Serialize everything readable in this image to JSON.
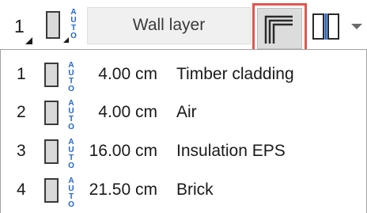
{
  "toolbar": {
    "layer_number": "1",
    "auto_label": [
      "A",
      "U",
      "T",
      "O"
    ],
    "layer_button_label": "Wall layer",
    "icons": {
      "swatch": "layer-swatch-icon",
      "corner": "corner-layers-icon",
      "split": "split-columns-icon",
      "dropdown": "chevron-down-icon"
    },
    "highlight_color": "#e2554f"
  },
  "layers": [
    {
      "number": "1",
      "thickness": "4.00 cm",
      "name": "Timber cladding"
    },
    {
      "number": "2",
      "thickness": "4.00 cm",
      "name": "Air"
    },
    {
      "number": "3",
      "thickness": "16.00 cm",
      "name": "Insulation EPS"
    },
    {
      "number": "4",
      "thickness": "21.50 cm",
      "name": "Brick"
    }
  ]
}
